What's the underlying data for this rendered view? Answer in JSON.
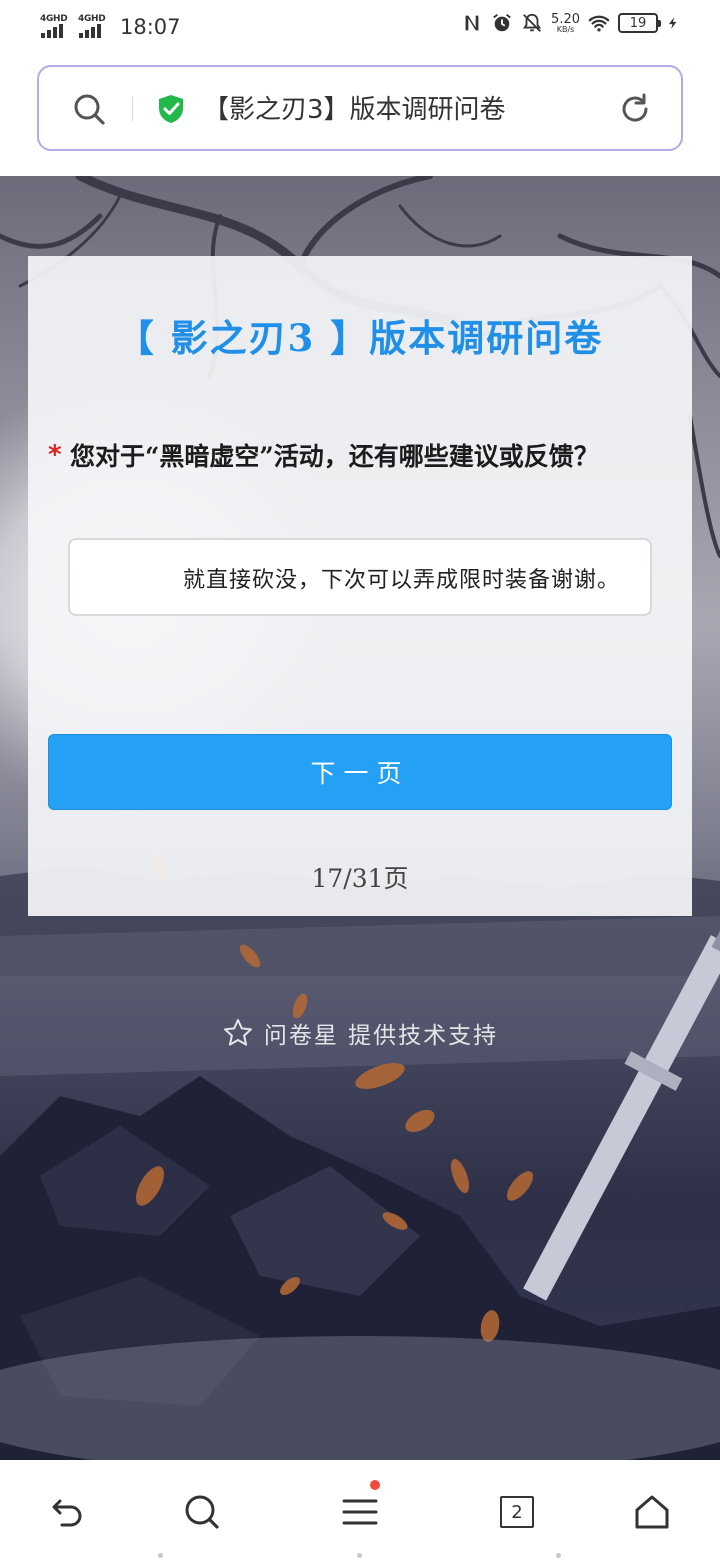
{
  "status_bar": {
    "network1": "4GHD",
    "network2": "4GHD",
    "time": "18:07",
    "net_speed_value": "5.20",
    "net_speed_unit": "KB/s",
    "battery": "19",
    "icons": [
      "nfc-icon",
      "alarm-icon",
      "mute-icon",
      "wifi-icon",
      "battery-icon",
      "charging-icon"
    ]
  },
  "address_bar": {
    "title": "【影之刃3】版本调研问卷",
    "secure": true
  },
  "survey": {
    "title": "【 影之刃3 】版本调研问卷",
    "required_mark": "*",
    "question": "您对于“黑暗虚空”活动，还有哪些建议或反馈？",
    "answer_value": "就直接砍没，下次可以弄成限时装备谢谢。",
    "next_button": "下一页",
    "page_indicator": "17/31页"
  },
  "footer": {
    "powered_by": "问卷星 提供技术支持"
  },
  "bottom_nav": {
    "tab_count": "2",
    "menu_has_notification": true
  },
  "colors": {
    "accent": "#24a0f5",
    "title_blue": "#1f8fe8",
    "required": "#e02020",
    "address_border": "#b9a8e6"
  }
}
